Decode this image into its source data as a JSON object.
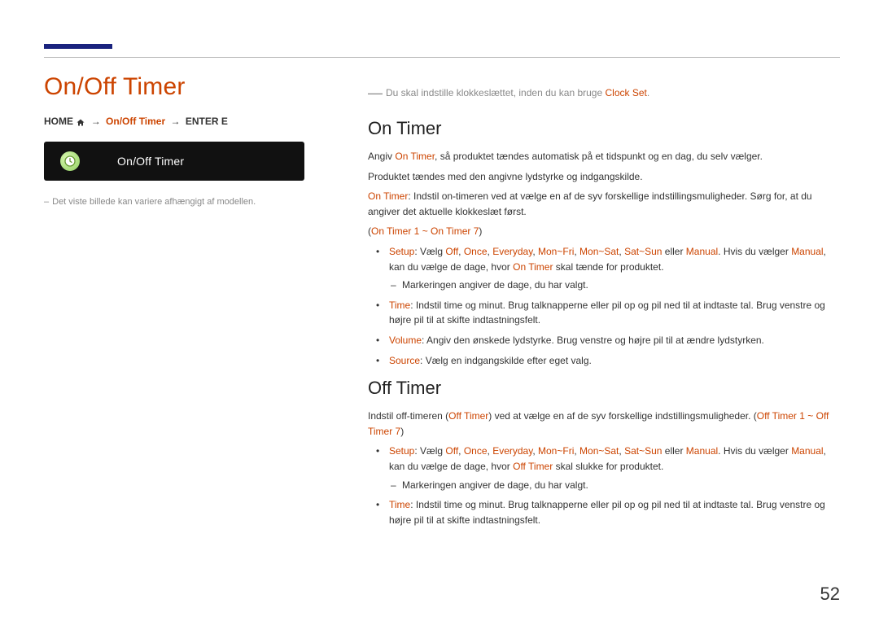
{
  "page_number": "52",
  "left": {
    "title": "On/Off Timer",
    "bc_home": "HOME",
    "bc_mid": "On/Off Timer",
    "bc_tail": "ENTER E",
    "tile_label": "On/Off Timer",
    "caption": "Det viste billede kan variere afhængigt af modellen."
  },
  "right": {
    "note_pre": "Du skal indstille klokkeslættet, inden du kan bruge ",
    "note_hl": "Clock Set",
    "note_post": ".",
    "sec1_h": "On Timer",
    "sec1_p1_a": "Angiv ",
    "sec1_p1_hl": "On Timer",
    "sec1_p1_b": ", så produktet tændes automatisk på et tidspunkt og en dag, du selv vælger.",
    "sec1_p2": "Produktet tændes med den angivne lydstyrke og indgangskilde.",
    "sec1_p3_hl": "On Timer",
    "sec1_p3_b": ": Indstil on-timeren ved at vælge en af de syv forskellige indstillingsmuligheder. Sørg for, at du angiver det aktuelle klokkeslæt først.",
    "sec1_p4_a": "(",
    "sec1_p4_hl": "On Timer 1",
    "sec1_p4_mid": " ~ ",
    "sec1_p4_hl2": "On Timer 7",
    "sec1_p4_b": ")",
    "b1_label": "Setup",
    "b1_a": ": Vælg ",
    "b1_opt1": "Off",
    "b1_opt2": "Once",
    "b1_opt3": "Everyday",
    "b1_opt4": "Mon~Fri",
    "b1_opt5": "Mon~Sat",
    "b1_opt6": "Sat~Sun",
    "b1_or": " eller ",
    "b1_opt7": "Manual",
    "b1_b": ". Hvis du vælger ",
    "b1_c": ", kan du vælge de dage, hvor ",
    "b1_hlmid": "On Timer",
    "b1_d": " skal tænde for produktet.",
    "b1_sub": "Markeringen angiver de dage, du har valgt.",
    "b2_label": "Time",
    "b2_txt": ": Indstil time og minut. Brug talknapperne eller pil op og pil ned til at indtaste tal. Brug venstre og højre pil til at skifte indtastningsfelt.",
    "b3_label": "Volume",
    "b3_txt": ": Angiv den ønskede lydstyrke. Brug venstre og højre pil til at ændre lydstyrken.",
    "b4_label": "Source",
    "b4_txt": ": Vælg en indgangskilde efter eget valg.",
    "sec2_h": "Off Timer",
    "sec2_p1_a": "Indstil off-timeren (",
    "sec2_p1_hl": "Off Timer",
    "sec2_p1_b": ") ved at vælge en af de syv forskellige indstillingsmuligheder. (",
    "sec2_p1_hl2": "Off Timer 1",
    "sec2_p1_mid": " ~ ",
    "sec2_p1_hl3": "Off Timer 7",
    "sec2_p1_c": ")",
    "c1_hlmid": "Off Timer",
    "c1_d": " skal slukke for produktet.",
    "comma": ", "
  }
}
